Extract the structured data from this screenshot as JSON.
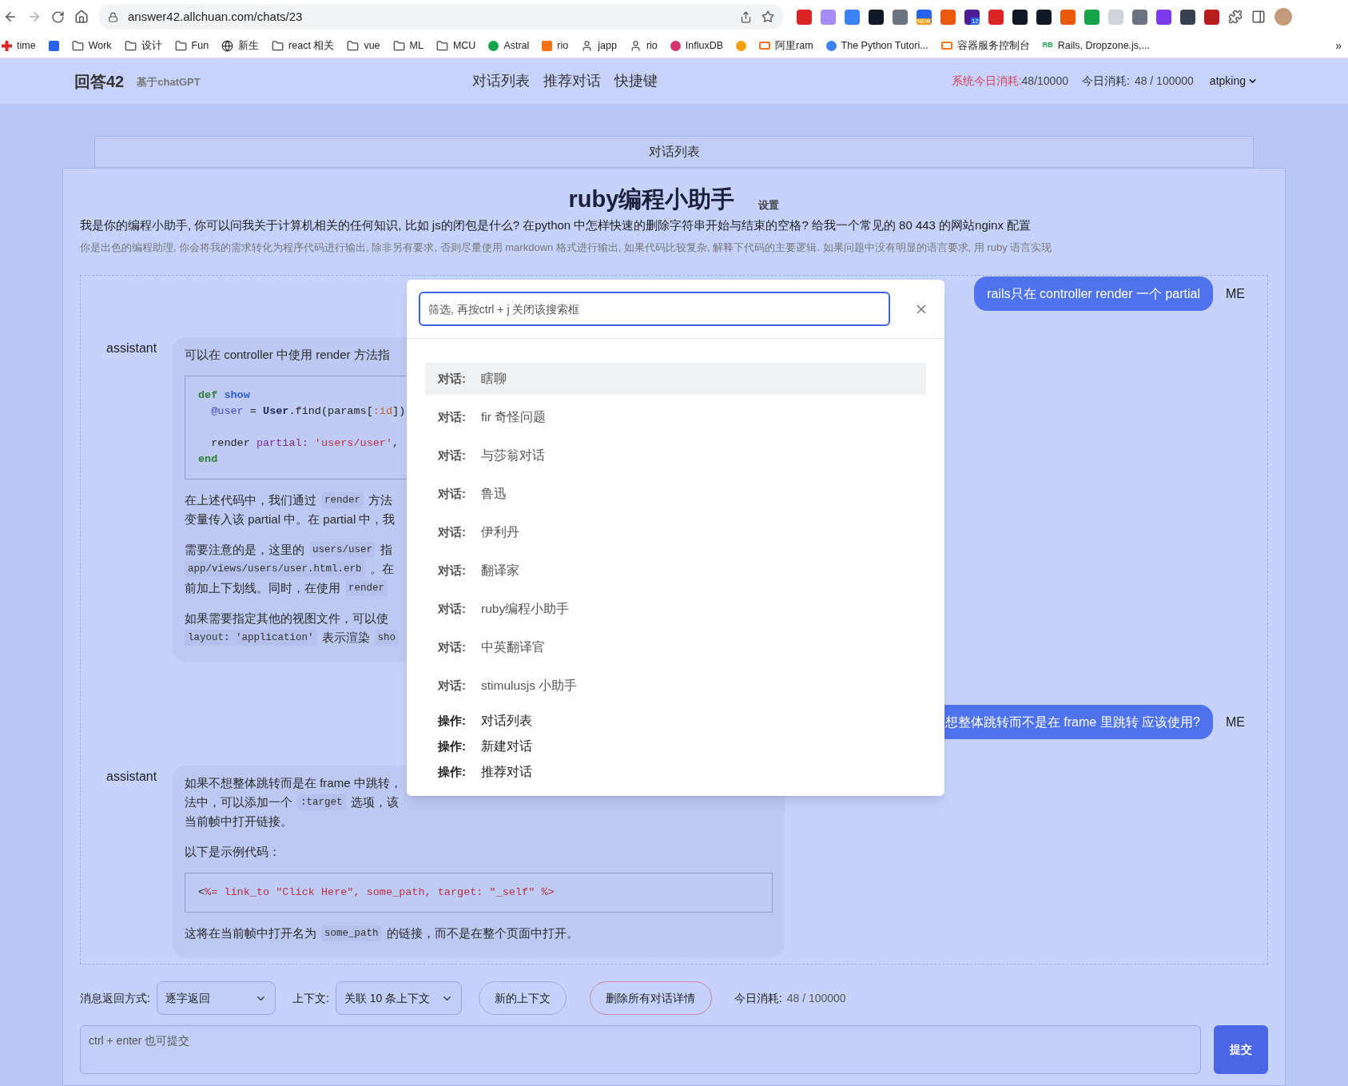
{
  "browser": {
    "url": "answer42.allchuan.com/chats/23",
    "badges": [
      "NEW",
      "12"
    ],
    "bookmarks": [
      {
        "kind": "site",
        "label": "time",
        "color": "#dc2626"
      },
      {
        "kind": "site",
        "color": "#2563eb"
      },
      {
        "kind": "folder",
        "label": "Work"
      },
      {
        "kind": "folder",
        "label": "设计"
      },
      {
        "kind": "folder",
        "label": "Fun"
      },
      {
        "kind": "globe",
        "label": "新生"
      },
      {
        "kind": "folder",
        "label": "react 相关"
      },
      {
        "kind": "folder",
        "label": "vue"
      },
      {
        "kind": "folder",
        "label": "ML"
      },
      {
        "kind": "folder",
        "label": "MCU"
      },
      {
        "kind": "site",
        "label": "Astral",
        "color": "#16a34a"
      },
      {
        "kind": "site",
        "label": "rio",
        "color": "#f97316"
      },
      {
        "kind": "person",
        "label": "japp"
      },
      {
        "kind": "person",
        "label": "rio"
      },
      {
        "kind": "site",
        "label": "InfluxDB",
        "color": "#d6336c"
      },
      {
        "kind": "site",
        "color": "#f59e0b"
      },
      {
        "kind": "site",
        "label": "阿里ram",
        "color": "#f97316"
      },
      {
        "kind": "site",
        "label": "The Python Tutori...",
        "color": "#3b82f6"
      },
      {
        "kind": "site",
        "label": "容器服务控制台",
        "color": "#f97316"
      },
      {
        "kind": "text",
        "favicon": "RB",
        "label": "Rails, Dropzone.js,...",
        "color": "#16a34a"
      }
    ],
    "overflow": "»"
  },
  "header": {
    "brand": "回答42",
    "tagline": "基于chatGPT",
    "nav": [
      "对话列表",
      "推荐对话",
      "快捷键"
    ],
    "system_usage_label": "系统今日消耗:",
    "system_usage": "48/10000",
    "usage_label": "今日消耗:",
    "usage": "48 / 100000",
    "user": "atpking"
  },
  "tab": "对话列表",
  "assistant_info": {
    "title": "ruby编程小助手",
    "settings": "设置",
    "description": "我是你的编程小助手, 你可以问我关于计算机相关的任何知识, 比如 js的闭包是什么? 在python 中怎样快速的删除字符串开始与结束的空格? 给我一个常见的 80 443 的网站nginx 配置",
    "prompt": "你是出色的编程助理, 你会将我的需求转化为程序代码进行输出, 除非另有要求, 否则尽量使用 markdown 格式进行输出, 如果代码比较复杂, 解释下代码的主要逻辑. 如果问题中没有明显的语言要求, 用 ruby 语言实现"
  },
  "messages": [
    {
      "kind": "user",
      "label": "ME",
      "text": "rails只在 controller render 一个 partial"
    },
    {
      "kind": "assistant",
      "label": "assistant",
      "blocks": [
        {
          "kind": "para",
          "lines": [
            [
              {
                "kind": "plain",
                "text": "可以在 controller 中使用 render 方法指"
              }
            ]
          ]
        },
        {
          "kind": "code",
          "lines": [
            {
              "tokens": [
                {
                  "kind": "keyword",
                  "text": "def"
                },
                {
                  "kind": "function",
                  "text": " show"
                }
              ]
            },
            {
              "tokens": [
                {
                  "kind": "variable",
                  "text": "  @user"
                },
                {
                  "kind": "plain",
                  "text": " = "
                },
                {
                  "kind": "constant",
                  "text": "User"
                },
                {
                  "kind": "plain",
                  "text": ".find(params["
                },
                {
                  "kind": "symbol",
                  "text": ":id"
                },
                {
                  "kind": "plain",
                  "text": "])"
                }
              ]
            },
            {
              "spaced": true,
              "tokens": [
                {
                  "kind": "plain",
                  "text": "  render "
                },
                {
                  "kind": "attribute",
                  "text": "partial:"
                },
                {
                  "kind": "string",
                  "text": " 'users/user'"
                },
                {
                  "kind": "plain",
                  "text": ","
                }
              ]
            },
            {
              "tokens": [
                {
                  "kind": "keyword",
                  "text": "end"
                }
              ]
            }
          ]
        },
        {
          "kind": "para",
          "lines": [
            [
              {
                "kind": "plain",
                "text": "在上述代码中，我们通过"
              },
              {
                "kind": "code",
                "text": "render"
              },
              {
                "kind": "plain",
                "text": "方法"
              }
            ],
            [
              {
                "kind": "plain",
                "text": "变量传入该 partial 中。在 partial 中，我"
              }
            ]
          ]
        },
        {
          "kind": "para",
          "lines": [
            [
              {
                "kind": "plain",
                "text": "需要注意的是，这里的"
              },
              {
                "kind": "code",
                "text": "users/user"
              },
              {
                "kind": "plain",
                "text": "指"
              }
            ],
            [
              {
                "kind": "code",
                "text": "app/views/users/user.html.erb"
              },
              {
                "kind": "plain",
                "text": "。在"
              }
            ],
            [
              {
                "kind": "plain",
                "text": "前加上下划线。同时，在使用"
              },
              {
                "kind": "code",
                "text": "render"
              }
            ]
          ]
        },
        {
          "kind": "para",
          "lines": [
            [
              {
                "kind": "plain",
                "text": "如果需要指定其他的视图文件，可以使"
              }
            ],
            [
              {
                "kind": "code",
                "text": "layout: 'application'"
              },
              {
                "kind": "plain",
                "text": "表示渲染"
              },
              {
                "kind": "code",
                "text": "sho"
              }
            ]
          ]
        }
      ]
    },
    {
      "kind": "user",
      "label": "ME",
      "text": "想整体跳转而不是在 frame 里跳转 应该使用?"
    },
    {
      "kind": "assistant",
      "label": "assistant",
      "blocks": [
        {
          "kind": "para",
          "lines": [
            [
              {
                "kind": "plain",
                "text": "如果不想整体跳转而是在 frame 中跳转，"
              }
            ],
            [
              {
                "kind": "plain",
                "text": "法中，可以添加一个"
              },
              {
                "kind": "code",
                "text": ":target"
              },
              {
                "kind": "plain",
                "text": "选项，该"
              }
            ],
            [
              {
                "kind": "plain",
                "text": "当前帧中打开链接。"
              }
            ]
          ]
        },
        {
          "kind": "para",
          "lines": [
            [
              {
                "kind": "plain",
                "text": "以下是示例代码："
              }
            ]
          ]
        },
        {
          "kind": "code",
          "lines": [
            {
              "tokens": [
                {
                  "kind": "plain",
                  "text": "<"
                },
                {
                  "kind": "string",
                  "text": "%= link_to \"Click Here\", some_path, target: \"_self\" %>"
                }
              ]
            }
          ]
        },
        {
          "kind": "para",
          "lines": [
            [
              {
                "kind": "plain",
                "text": "这将在当前帧中打开名为"
              },
              {
                "kind": "code",
                "text": "some_path"
              },
              {
                "kind": "plain",
                "text": "的链接，而不是在整个页面中打开。"
              }
            ]
          ]
        }
      ]
    }
  ],
  "palette": {
    "placeholder": "筛选, 再按ctrl + j 关闭该搜索框",
    "items": [
      {
        "kind": "conversation",
        "prefix": "对话:",
        "label": "瞎聊",
        "selected": true
      },
      {
        "kind": "conversation",
        "prefix": "对话:",
        "label": "fir 奇怪问题",
        "selected": false
      },
      {
        "kind": "conversation",
        "prefix": "对话:",
        "label": "与莎翁对话",
        "selected": false
      },
      {
        "kind": "conversation",
        "prefix": "对话:",
        "label": "鲁迅",
        "selected": false
      },
      {
        "kind": "conversation",
        "prefix": "对话:",
        "label": "伊利丹",
        "selected": false
      },
      {
        "kind": "conversation",
        "prefix": "对话:",
        "label": "翻译家",
        "selected": false
      },
      {
        "kind": "conversation",
        "prefix": "对话:",
        "label": "ruby编程小助手",
        "selected": false
      },
      {
        "kind": "conversation",
        "prefix": "对话:",
        "label": "中英翻译官",
        "selected": false
      },
      {
        "kind": "conversation",
        "prefix": "对话:",
        "label": "stimulusjs 小助手",
        "selected": false
      },
      {
        "kind": "action",
        "prefix": "操作:",
        "label": "对话列表",
        "selected": false
      },
      {
        "kind": "action",
        "prefix": "操作:",
        "label": "新建对话",
        "selected": false
      },
      {
        "kind": "action",
        "prefix": "操作:",
        "label": "推荐对话",
        "selected": false
      }
    ]
  },
  "controls": {
    "mode_label": "消息返回方式:",
    "mode": "逐字返回",
    "context_label": "上下文:",
    "context": "关联 10 条上下文",
    "new_context": "新的上下文",
    "delete_all": "删除所有对话详情",
    "usage_label": "今日消耗:",
    "usage": "48 / 100000",
    "input_placeholder": "ctrl + enter 也可提交",
    "submit": "提交"
  }
}
